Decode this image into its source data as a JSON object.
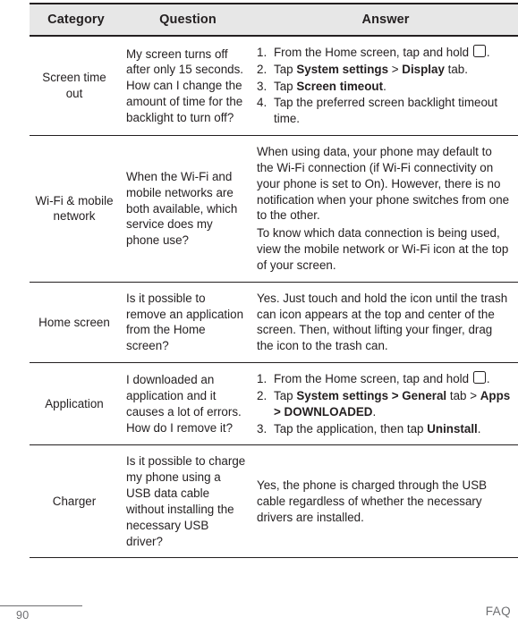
{
  "document": {
    "footer_section": "FAQ",
    "page_number": "90"
  },
  "table": {
    "headers": {
      "category": "Category",
      "question": "Question",
      "answer": "Answer"
    },
    "rows": [
      {
        "category": "Screen time out",
        "question": "My screen turns off after only 15 seconds. How can I change the amount of time for the backlight to turn off?",
        "answer_type": "list",
        "answer_steps": [
          {
            "pre": "From the Home screen, tap and hold ",
            "icon": "menu-key-icon",
            "post": "."
          },
          {
            "pre": "Tap ",
            "bold1": "System settings",
            "mid": " > ",
            "bold2": "Display",
            "post": " tab."
          },
          {
            "pre": "Tap ",
            "bold1": "Screen timeout",
            "post": "."
          },
          {
            "pre": "Tap the preferred screen backlight timeout time.",
            "post": ""
          }
        ]
      },
      {
        "category": "Wi-Fi & mobile network",
        "question": "When the Wi-Fi and mobile networks are both available, which service does my phone use?",
        "answer_type": "paragraphs",
        "answer_paragraphs": [
          "When using data, your phone may default to the Wi-Fi connection (if Wi-Fi connectivity on your phone is set to On). However, there is no notification when your phone switches from one to the other.",
          "To know which data connection is being used, view the mobile network or Wi-Fi icon at the top of your screen."
        ]
      },
      {
        "category": "Home screen",
        "question": "Is it possible to remove an application from the Home screen?",
        "answer_type": "paragraphs",
        "answer_paragraphs": [
          "Yes. Just touch and hold the icon until the trash can icon appears at the top and center of the screen. Then, without lifting your finger, drag the icon to the trash can."
        ]
      },
      {
        "category": "Application",
        "question": "I downloaded an application and it causes a lot of errors. How do I remove it?",
        "answer_type": "list",
        "answer_steps": [
          {
            "pre": "From the Home screen, tap and hold ",
            "icon": "menu-key-icon",
            "post": "."
          },
          {
            "pre": "Tap ",
            "bold1": "System settings > General",
            "mid": " tab > ",
            "bold2": "Apps > DOWNLOADED",
            "post": "."
          },
          {
            "pre": "Tap the application, then tap ",
            "bold1": "Uninstall",
            "post": "."
          }
        ]
      },
      {
        "category": "Charger",
        "question": "Is it possible to charge my phone using a USB data cable without installing the necessary USB driver?",
        "answer_type": "paragraphs",
        "answer_paragraphs": [
          "Yes, the phone is charged through the USB cable regardless of whether the necessary drivers are installed."
        ]
      }
    ]
  }
}
